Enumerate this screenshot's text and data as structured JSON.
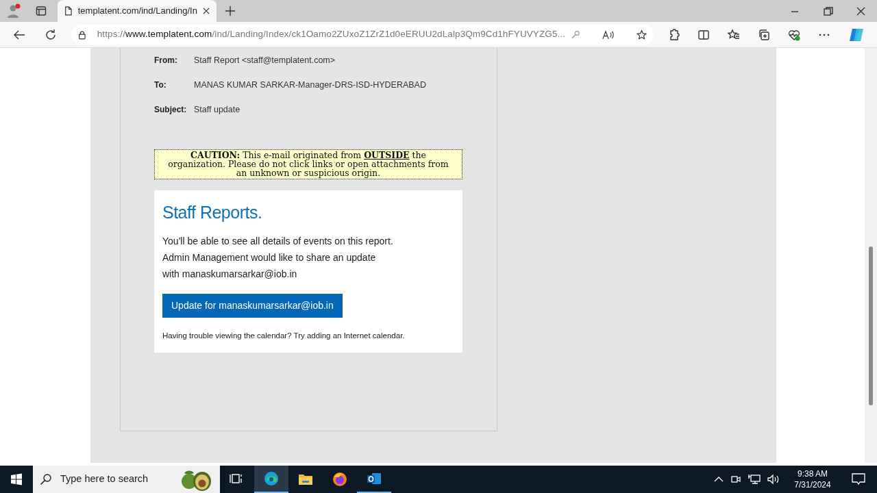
{
  "browser": {
    "tab": {
      "title": "templatent.com/ind/Landing/In",
      "selected": true
    },
    "address": {
      "scheme": "https://",
      "host": "www.templatent.com",
      "path": "/ind/Landing/Index/ck1Oamo2ZUxoZ1ZrZ1d0eERUU2dLalp3Qm9Cd1hFYUVYZG5..."
    }
  },
  "email": {
    "fields": [
      {
        "label": "From:",
        "value": "Staff Report <staff@templatent.com>"
      },
      {
        "label": "To:",
        "value": "MANAS KUMAR SARKAR-Manager-DRS-ISD-HYDERABAD"
      },
      {
        "label": "Subject:",
        "value": "Staff update"
      }
    ],
    "caution": "**CAUTION:** This e-mail originated from **OUTSIDE** the organization. Please do not click links or open attachments from an unknown or suspicious origin.",
    "card": {
      "heading": "Staff Reports.",
      "lines": [
        "You'll be able to see all details of events on this report.",
        "Admin Management would like to share an update",
        "with manaskumarsarkar@iob.in"
      ],
      "button": "Update for manaskumarsarkar@iob.in",
      "note": "Having trouble viewing the calendar? Try adding an Internet calendar."
    }
  },
  "taskbar": {
    "search": {
      "placeholder": "Type here to search"
    },
    "apps": [
      {
        "kind": "taskview",
        "selected": false,
        "running": false
      },
      {
        "kind": "edge",
        "selected": true,
        "running": true
      },
      {
        "kind": "folder",
        "selected": false,
        "running": false
      },
      {
        "kind": "firefox",
        "selected": false,
        "running": false
      },
      {
        "kind": "outlook",
        "selected": false,
        "running": true
      }
    ],
    "time": "9:38 AM",
    "date": "7/31/2024"
  }
}
